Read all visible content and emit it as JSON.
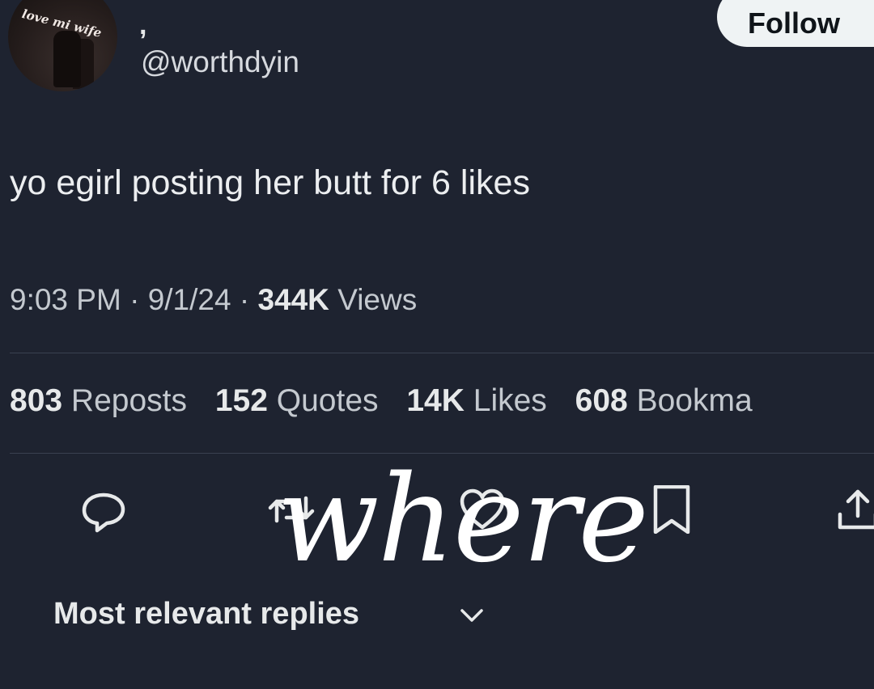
{
  "author": {
    "avatar_text": "love mi wife",
    "display_name": ",",
    "handle": "@worthdyin",
    "follow_label": "Follow"
  },
  "tweet": {
    "text": "yo egirl posting her butt for 6 likes",
    "time": "9:03 PM",
    "date": "9/1/24",
    "views_count": "344K",
    "views_label": "Views",
    "separator": "·"
  },
  "stats": [
    {
      "count": "803",
      "label": "Reposts"
    },
    {
      "count": "152",
      "label": "Quotes"
    },
    {
      "count": "14K",
      "label": "Likes"
    },
    {
      "count": "608",
      "label": "Bookma"
    }
  ],
  "actions": [
    {
      "icon": "reply-icon"
    },
    {
      "icon": "repost-icon"
    },
    {
      "icon": "like-icon"
    },
    {
      "icon": "bookmark-icon"
    },
    {
      "icon": "share-icon"
    }
  ],
  "replies": {
    "label": "Most relevant replies",
    "dropdown_icon": "chevron-down-icon"
  },
  "overlay": {
    "word": "where"
  },
  "colors": {
    "background": "#1e2330",
    "text_primary": "#e7e9ea",
    "text_secondary": "#c4c9cf",
    "divider": "#3a4150",
    "follow_bg": "#eff3f4"
  }
}
